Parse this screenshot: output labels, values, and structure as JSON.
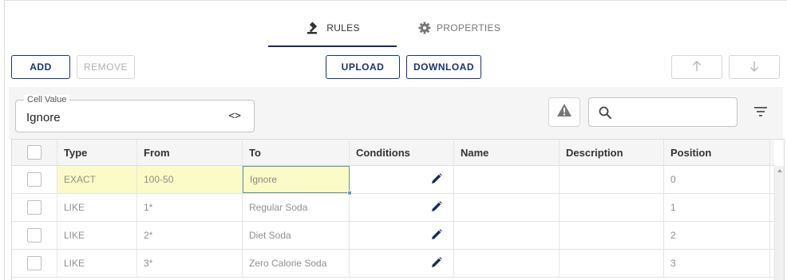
{
  "tabs": [
    {
      "label": "RULES",
      "icon": "gavel-icon",
      "active": true
    },
    {
      "label": "PROPERTIES",
      "icon": "gear-icon",
      "active": false
    }
  ],
  "toolbar": {
    "add_label": "ADD",
    "remove_label": "REMOVE",
    "upload_label": "UPLOAD",
    "download_label": "DOWNLOAD",
    "move_up_icon": "arrow-up-icon",
    "move_down_icon": "arrow-down-icon"
  },
  "filter": {
    "cell_value_label": "Cell Value",
    "cell_value": "Ignore",
    "code_toggle": "<>",
    "search_value": "",
    "search_placeholder": ""
  },
  "grid": {
    "columns": [
      "Type",
      "From",
      "To",
      "Conditions",
      "Name",
      "Description",
      "Position"
    ],
    "rows": [
      {
        "type": "EXACT",
        "from": "100-50",
        "to": "Ignore",
        "name": "",
        "description": "",
        "position": "0"
      },
      {
        "type": "LIKE",
        "from": "1*",
        "to": "Regular Soda",
        "name": "",
        "description": "",
        "position": "1"
      },
      {
        "type": "LIKE",
        "from": "2*",
        "to": "Diet Soda",
        "name": "",
        "description": "",
        "position": "2"
      },
      {
        "type": "LIKE",
        "from": "3*",
        "to": "Zero Calorie Soda",
        "name": "",
        "description": "",
        "position": "3"
      }
    ]
  },
  "colors": {
    "accent": "#1a3276",
    "edited_cell": "#fbfbc8",
    "focus_border": "#5c9a86"
  }
}
